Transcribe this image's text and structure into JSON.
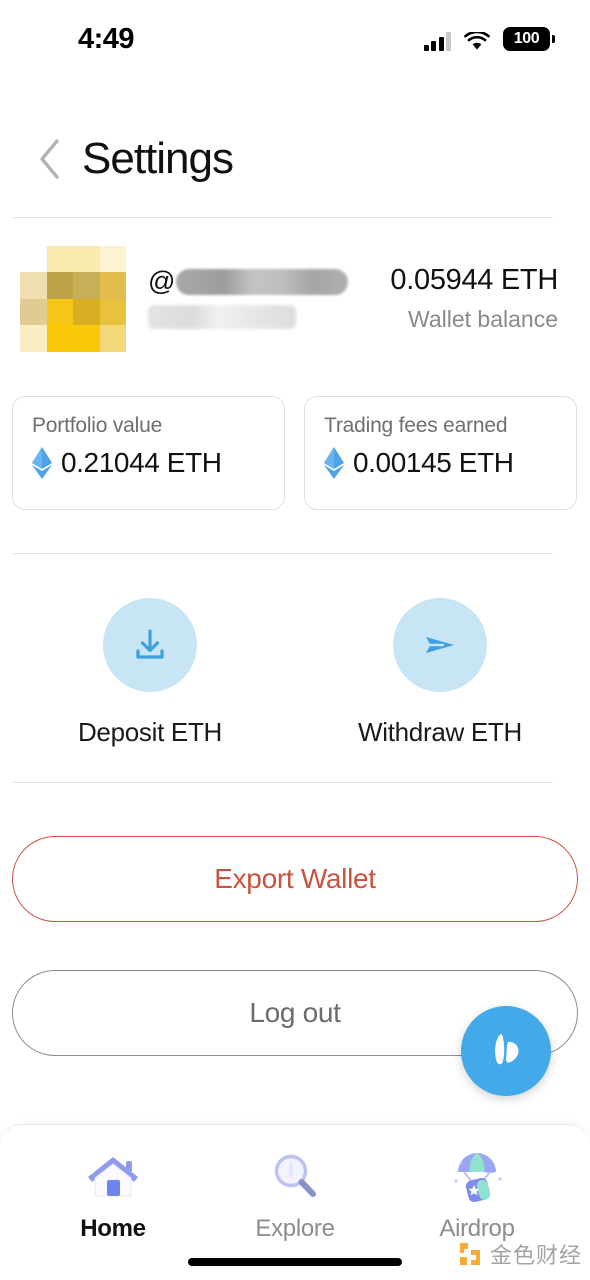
{
  "status_bar": {
    "time": "4:49",
    "battery_level": "100",
    "signal_icon": "cellular-signal-icon",
    "wifi_icon": "wifi-icon",
    "battery_icon": "battery-icon"
  },
  "header": {
    "back_icon": "chevron-left-icon",
    "title": "Settings"
  },
  "profile": {
    "avatar_name": "user-avatar-pixelated",
    "at_symbol": "@",
    "username_redacted": "",
    "subtitle_redacted": "",
    "balance_value": "0.05944 ETH",
    "balance_label": "Wallet balance"
  },
  "stats": [
    {
      "label": "Portfolio value",
      "value": "0.21044 ETH",
      "icon": "ethereum-icon",
      "name": "portfolio-value-card"
    },
    {
      "label": "Trading fees earned",
      "value": "0.00145 ETH",
      "icon": "ethereum-icon",
      "name": "trading-fees-earned-card"
    }
  ],
  "actions": [
    {
      "label": "Deposit ETH",
      "icon": "download-icon",
      "name": "deposit-eth-button"
    },
    {
      "label": "Withdraw ETH",
      "icon": "send-icon",
      "name": "withdraw-eth-button"
    }
  ],
  "buttons": {
    "export_wallet": "Export Wallet",
    "log_out": "Log out"
  },
  "fab": {
    "icon": "app-logo-icon",
    "label": ""
  },
  "bottom_nav": {
    "items": [
      {
        "label": "Home",
        "icon": "house-icon",
        "active": true
      },
      {
        "label": "Explore",
        "icon": "magnifier-icon",
        "active": false
      },
      {
        "label": "Airdrop",
        "icon": "parachute-gift-icon",
        "active": false
      }
    ]
  },
  "watermark": {
    "text": "金色财经",
    "mark": "jinse-logo-icon"
  },
  "colors": {
    "accent_blue": "#43a9e8",
    "soft_blue_bg": "#c7e5f5",
    "danger_red": "#c9533e",
    "muted_gray": "#8a8a8a",
    "eth_blue": "#4da2e8",
    "nav_periwinkle": "#8e9bf0",
    "watermark_orange": "#f5a623"
  }
}
